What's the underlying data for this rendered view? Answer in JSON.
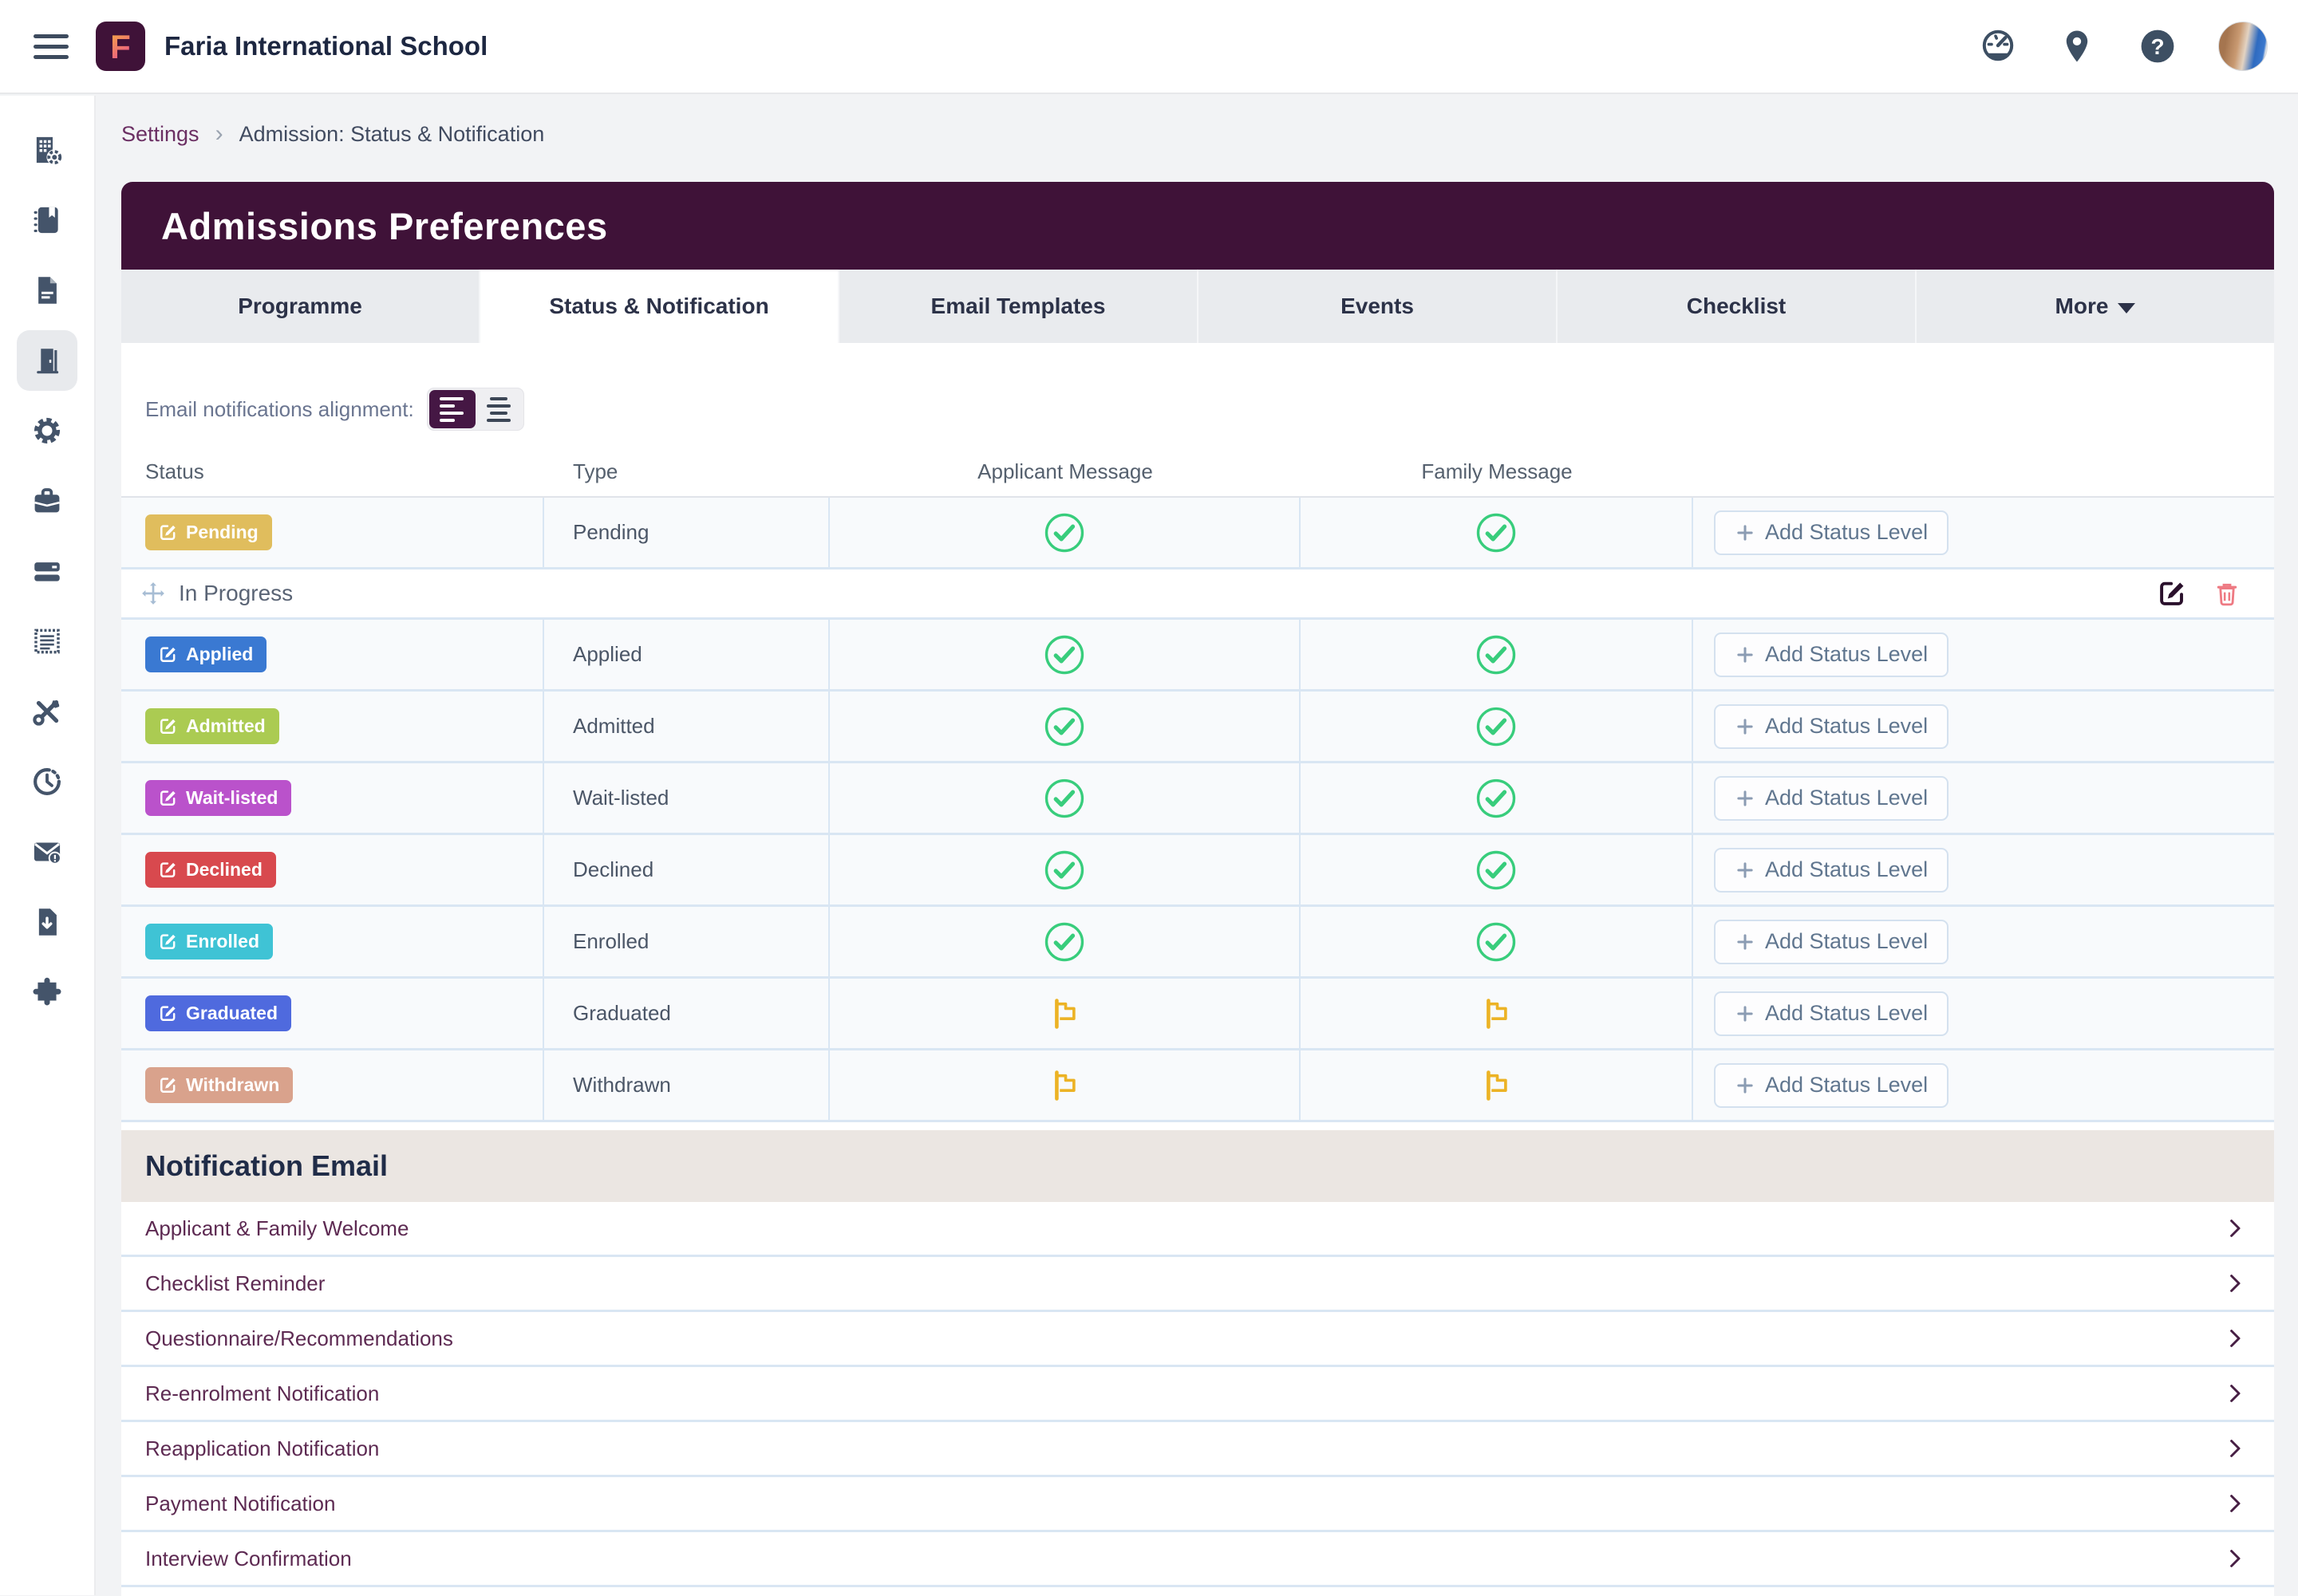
{
  "topbar": {
    "school_name": "Faria International School",
    "logo_letter": "F",
    "icons": [
      "menu-hamburger",
      "dashboard-gauge",
      "locations-pin",
      "help",
      "avatar"
    ]
  },
  "breadcrumb": {
    "settings": "Settings",
    "separator": "›",
    "current": "Admission: Status & Notification"
  },
  "header": {
    "title": "Admissions Preferences"
  },
  "tabs": [
    {
      "label": "Programme",
      "active": false
    },
    {
      "label": "Status & Notification",
      "active": true
    },
    {
      "label": "Email Templates",
      "active": false
    },
    {
      "label": "Events",
      "active": false
    },
    {
      "label": "Checklist",
      "active": false
    },
    {
      "label": "More",
      "active": false,
      "has_dropdown": true
    }
  ],
  "alignment": {
    "label": "Email notifications alignment:",
    "options": [
      "align-left",
      "align-center"
    ],
    "selected": "align-left"
  },
  "status_table": {
    "columns": [
      "Status",
      "Type",
      "Applicant Message",
      "Family Message"
    ],
    "add_status_label": "Add Status Level",
    "group_row": {
      "label": "In Progress",
      "actions": [
        "edit",
        "delete"
      ]
    },
    "rows": [
      {
        "badge": "Pending",
        "badge_color": "#e0bd5d",
        "type": "Pending",
        "applicant_message": "check",
        "family_message": "check",
        "group": null
      },
      {
        "badge": "Applied",
        "badge_color": "#3a79d2",
        "type": "Applied",
        "applicant_message": "check",
        "family_message": "check",
        "group": "In Progress"
      },
      {
        "badge": "Admitted",
        "badge_color": "#abcb52",
        "type": "Admitted",
        "applicant_message": "check",
        "family_message": "check",
        "group": "In Progress"
      },
      {
        "badge": "Wait-listed",
        "badge_color": "#ba52cb",
        "type": "Wait-listed",
        "applicant_message": "check",
        "family_message": "check",
        "group": "In Progress"
      },
      {
        "badge": "Declined",
        "badge_color": "#d8494e",
        "type": "Declined",
        "applicant_message": "check",
        "family_message": "check",
        "group": "In Progress"
      },
      {
        "badge": "Enrolled",
        "badge_color": "#3fc3d5",
        "type": "Enrolled",
        "applicant_message": "check",
        "family_message": "check",
        "group": "In Progress"
      },
      {
        "badge": "Graduated",
        "badge_color": "#4f6ade",
        "type": "Graduated",
        "applicant_message": "flag",
        "family_message": "flag",
        "group": "In Progress"
      },
      {
        "badge": "Withdrawn",
        "badge_color": "#d9a28c",
        "type": "Withdrawn",
        "applicant_message": "flag",
        "family_message": "flag",
        "group": "In Progress"
      }
    ]
  },
  "notification_email": {
    "title": "Notification Email",
    "items": [
      "Applicant & Family Welcome",
      "Checklist Reminder",
      "Questionnaire/Recommendations",
      "Re-enrolment Notification",
      "Reapplication Notification",
      "Payment Notification",
      "Interview Confirmation"
    ]
  },
  "sidebar": {
    "items": [
      {
        "icon": "school-building-icon",
        "active": false
      },
      {
        "icon": "notebook-icon",
        "active": false
      },
      {
        "icon": "document-icon",
        "active": false
      },
      {
        "icon": "admissions-door-icon",
        "active": true
      },
      {
        "icon": "gear-icon",
        "active": false
      },
      {
        "icon": "briefcase-icon",
        "active": false
      },
      {
        "icon": "billing-card-icon",
        "active": false
      },
      {
        "icon": "newsletter-icon",
        "active": false
      },
      {
        "icon": "tools-icon",
        "active": false
      },
      {
        "icon": "history-clock-icon",
        "active": false
      },
      {
        "icon": "mail-alert-icon",
        "active": false
      },
      {
        "icon": "export-file-icon",
        "active": false
      },
      {
        "icon": "integrations-puzzle-icon",
        "active": false
      }
    ]
  },
  "colors": {
    "header_purple": "#3f1238",
    "check_green": "#38cd7c",
    "flag_yellow": "#ecb325",
    "link_plum": "#5d2a52",
    "row_border": "#d9e6f3",
    "section_beige": "#ebe6e2"
  }
}
